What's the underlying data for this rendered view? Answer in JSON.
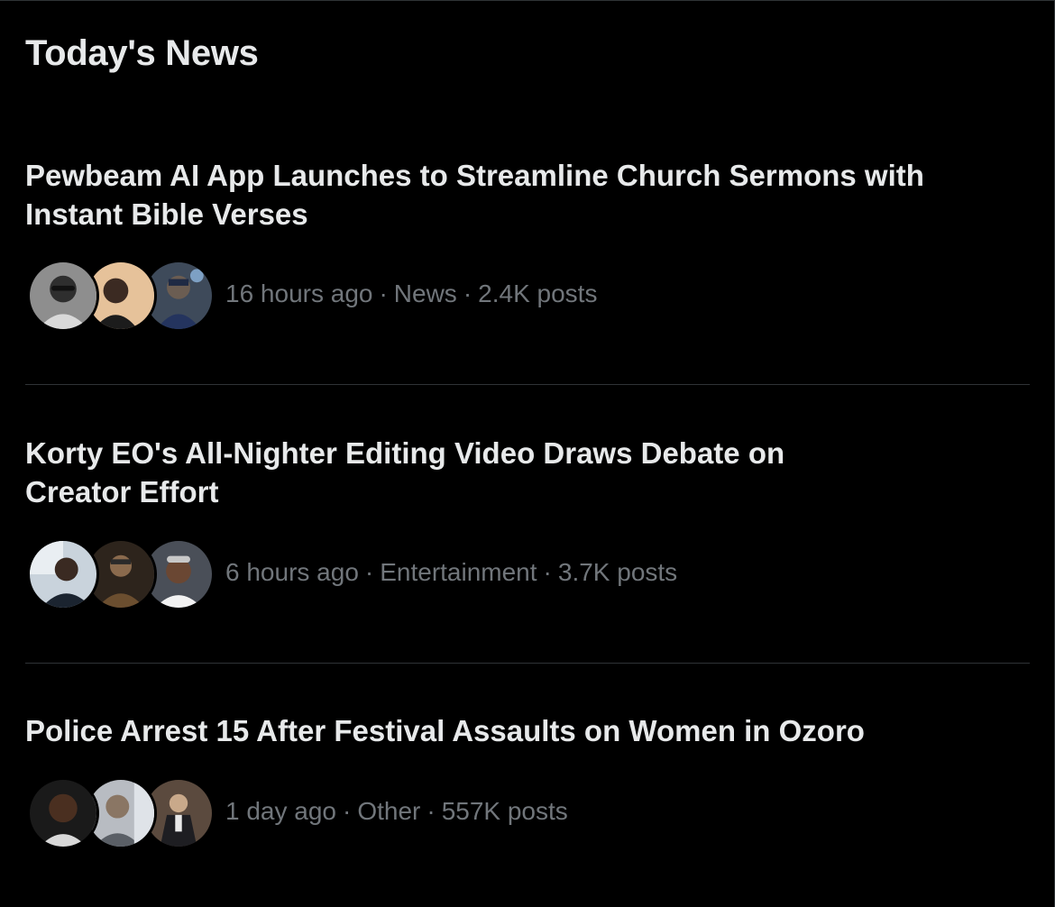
{
  "panel": {
    "title": "Today's News"
  },
  "news": [
    {
      "headline_line1": "Pewbeam AI App Launches to Streamline Church Sermons with",
      "headline_line2": "Instant Bible Verses",
      "time": "16 hours ago",
      "category": "News",
      "posts": "2.4K posts"
    },
    {
      "headline_line1": "Korty EO's All-Nighter Editing Video Draws Debate on",
      "headline_line2": "Creator Effort",
      "time": "6 hours ago",
      "category": "Entertainment",
      "posts": "3.7K posts"
    },
    {
      "headline_line1": "Police Arrest 15 After Festival Assaults on Women in Ozoro",
      "headline_line2": "",
      "time": "1 day ago",
      "category": "Other",
      "posts": "557K posts"
    }
  ],
  "separator": "·",
  "colors": {
    "background": "#000000",
    "headline": "#e7e9ea",
    "meta": "#71767b",
    "divider": "#2f3336"
  }
}
